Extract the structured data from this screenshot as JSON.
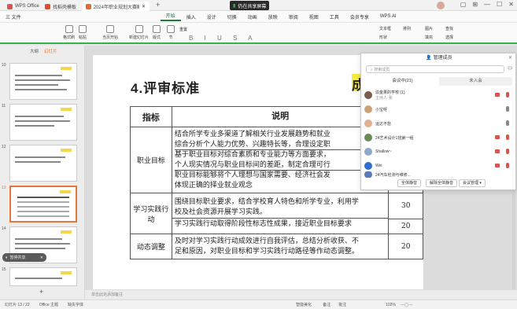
{
  "tabs": [
    {
      "label": "WPS Office",
      "color": "#d9534f"
    },
    {
      "label": "找稻壳模板",
      "color": "#e04b2e"
    },
    {
      "label": "2024年职业规划大赛解读(1)",
      "color": "#e86a2a"
    }
  ],
  "meeting_pill": "仍在共享屏幕",
  "menus": [
    "三 文件",
    "开始",
    "插入",
    "设计",
    "切换",
    "动画",
    "放映",
    "审阅",
    "视图",
    "工具",
    "会员专享",
    "WPS AI"
  ],
  "active_menu": "开始",
  "toolbar": {
    "format_painter": "格式刷",
    "paste": "粘贴",
    "current_start": "当页开始",
    "new_slide": "新建幻灯片",
    "layout": "版式",
    "section": "节",
    "reset": "重置",
    "textbox": "文本框",
    "shape": "形状",
    "arrange": "排列",
    "picture": "图片",
    "fill": "填充",
    "find": "查找",
    "select": "选择"
  },
  "sidebar": {
    "tabs": [
      "大纲",
      "幻灯片"
    ],
    "slide_numbers": [
      "10",
      "11",
      "12",
      "13",
      "14",
      "15"
    ],
    "selected": "13"
  },
  "slide": {
    "title": "4.评审标准",
    "title_highlight": "成",
    "table": {
      "headers": [
        "指标",
        "说明",
        ""
      ],
      "rows": [
        {
          "indicator": "职业目标",
          "lines": [
            "结合所学专业多渠道了解相关行业发展趋势和就业",
            "综合分析个人能力优势、兴趣特长等，合理设定职",
            "基于职业目标对综合素质和专业能力等方面要求，",
            "个人现实情况与职业目标间的差距，制定合理可行",
            "职业目标能够将个人理想与国家需要、经济社会发",
            "体现正确的择业就业观念"
          ],
          "score": ""
        },
        {
          "indicator": "学习实践行动",
          "lines": [
            "围绕目标职业要求，结合学校育人特色和所学专业，利用学",
            "校及社会资源开展学习实践。",
            "学习实践行动取得阶段性标志性成果，接近职业目标要求"
          ],
          "score": "30",
          "score2": "20"
        },
        {
          "indicator": "动态调整",
          "lines": [
            "及时对学习实践行动成效进行自我评估，总结分析收获、不",
            "足和原因，对职业目标和学习实践行动路径等作动态调整。"
          ],
          "score": "20"
        }
      ]
    }
  },
  "notes_placeholder": "单击此处添加备注",
  "meeting_panel": {
    "title": "管理成员",
    "search_placeholder": "搜索成员",
    "tabs": [
      "会议中(21)",
      "未入会"
    ],
    "members": [
      {
        "name": "渝金果的学校 (1)",
        "sub": "主持人·我",
        "color": "#7a5c4a",
        "mic": "red",
        "vid": "red"
      },
      {
        "name": "小宝呀",
        "sub": "",
        "color": "#c9a27a",
        "mic": "grey",
        "vid": ""
      },
      {
        "name": "运达不愁",
        "sub": "",
        "color": "#e0b090",
        "mic": "grey",
        "vid": ""
      },
      {
        "name": "24艺术设计1班第一组",
        "sub": "",
        "color": "#6a8a5a",
        "mic": "red",
        "vid": "red"
      },
      {
        "name": "Shallow~",
        "sub": "",
        "color": "#8fa9c9",
        "mic": "red",
        "vid": "red"
      },
      {
        "name": "Wei",
        "sub": "",
        "color": "#2f6fd0",
        "mic": "red",
        "vid": "red"
      },
      {
        "name": "24汽车检测与维修...",
        "sub": "",
        "color": "#5a7ab8",
        "mic": "red",
        "vid": "red"
      }
    ],
    "buttons": [
      "全体静音",
      "解除全体静音",
      "会议管理"
    ]
  },
  "toast": "暂停共享",
  "status": {
    "slide_count": "幻灯片 13 / 22",
    "theme": "Office 主题",
    "font_missing": "缺失字体",
    "smart_beautify": "智能美化",
    "notes": "备注",
    "comments": "批注",
    "zoom": "102%"
  }
}
